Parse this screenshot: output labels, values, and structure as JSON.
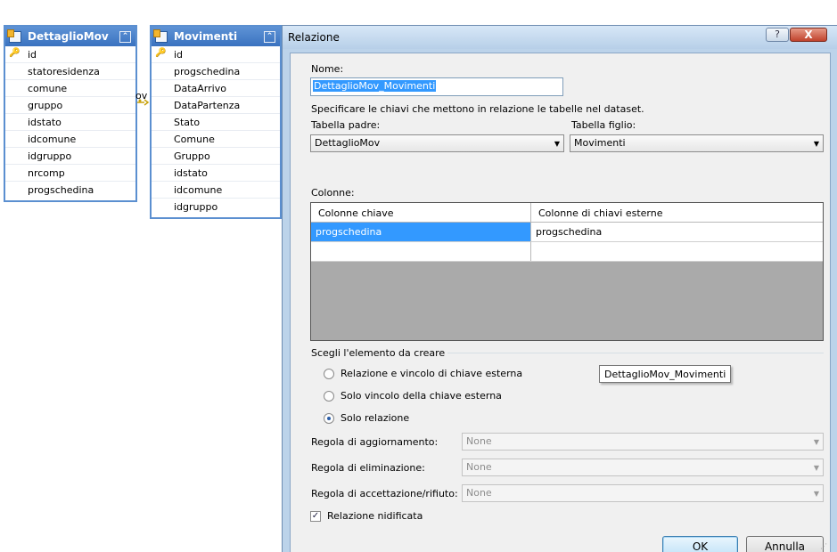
{
  "tables": {
    "left": {
      "title": "DettaglioMov",
      "collapse_icon": "collapse-icon",
      "fields": [
        {
          "name": "id",
          "key": true
        },
        {
          "name": "statoresidenza",
          "key": false
        },
        {
          "name": "comune",
          "key": false
        },
        {
          "name": "gruppo",
          "key": false
        },
        {
          "name": "idstato",
          "key": false
        },
        {
          "name": "idcomune",
          "key": false
        },
        {
          "name": "idgruppo",
          "key": false
        },
        {
          "name": "nrcomp",
          "key": false
        },
        {
          "name": "progschedina",
          "key": false
        }
      ]
    },
    "right": {
      "title": "Movimenti",
      "fields": [
        {
          "name": "id",
          "key": true
        },
        {
          "name": "progschedina",
          "key": false
        },
        {
          "name": "DataArrivo",
          "key": false
        },
        {
          "name": "DataPartenza",
          "key": false
        },
        {
          "name": "Stato",
          "key": false
        },
        {
          "name": "Comune",
          "key": false
        },
        {
          "name": "Gruppo",
          "key": false
        },
        {
          "name": "idstato",
          "key": false
        },
        {
          "name": "idcomune",
          "key": false
        },
        {
          "name": "idgruppo",
          "key": false
        }
      ]
    },
    "relation_label": "ov"
  },
  "dialog": {
    "title": "Relazione",
    "help": "?",
    "close": "X",
    "name_label": "Nome:",
    "name_value": "DettaglioMov_Movimenti",
    "description": "Specificare le chiavi che mettono in relazione le tabelle nel dataset.",
    "parent_label": "Tabella padre:",
    "parent_value": "DettaglioMov",
    "child_label": "Tabella figlio:",
    "child_value": "Movimenti",
    "columns_label": "Colonne:",
    "grid": {
      "headers": [
        "Colonne chiave",
        "Colonne di chiavi esterne"
      ],
      "rows": [
        [
          "progschedina",
          "progschedina"
        ],
        [
          "",
          ""
        ]
      ]
    },
    "create_group_label": "Scegli l'elemento da creare",
    "options": [
      {
        "label": "Relazione e vincolo di chiave esterna",
        "selected": false
      },
      {
        "label": "Solo vincolo della chiave esterna",
        "selected": false
      },
      {
        "label": "Solo relazione",
        "selected": true
      }
    ],
    "tooltip": "DettaglioMov_Movimenti",
    "update_rule_label": "Regola di aggiornamento:",
    "update_rule_value": "None",
    "delete_rule_label": "Regola di eliminazione:",
    "delete_rule_value": "None",
    "accept_rule_label": "Regola di accettazione/rifiuto:",
    "accept_rule_value": "None",
    "nested_label": "Relazione nidificata",
    "nested_checked": true,
    "ok": "OK",
    "cancel": "Annulla"
  },
  "colors": {
    "selection": "#3399ff",
    "table_header": "#3a72c0",
    "dialog_frame": "#bcd3ea"
  }
}
